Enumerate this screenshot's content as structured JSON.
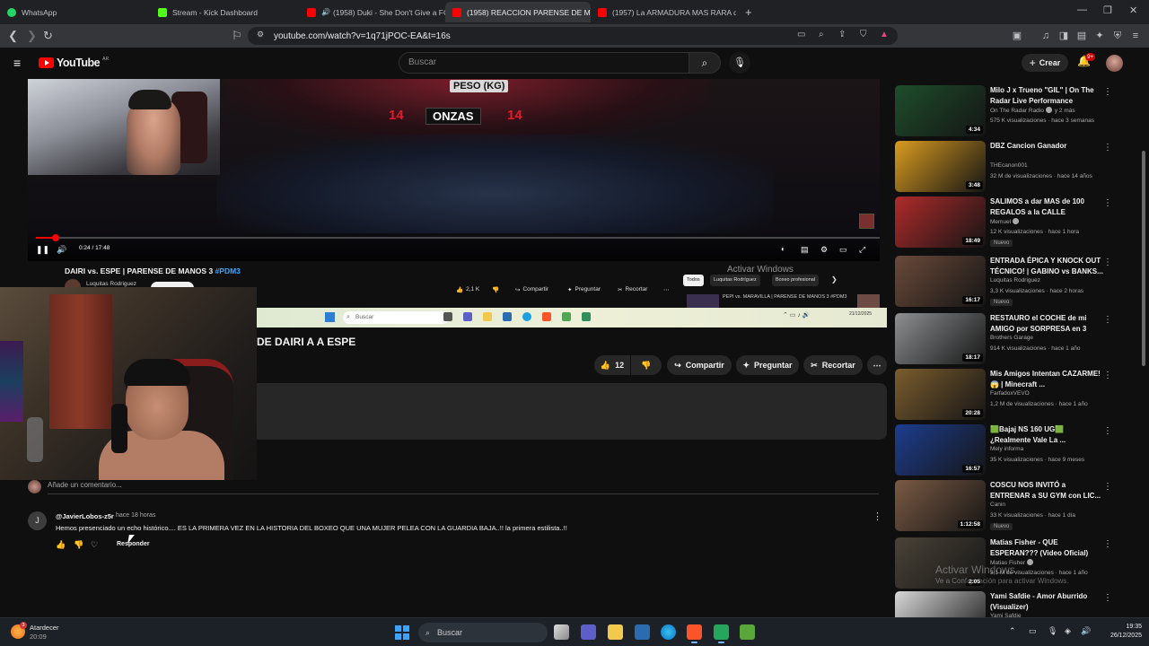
{
  "browser": {
    "tabs": [
      {
        "label": "WhatsApp",
        "fav_color": "#25d366",
        "active": false
      },
      {
        "label": "Stream - Kick Dashboard",
        "fav_color": "#53fc18",
        "active": false
      },
      {
        "label": "(1958) Duki - She Don't Give a FO",
        "fav_color": "#ff0000",
        "active": false
      },
      {
        "label": "(1958) REACCION PARENSE DE M",
        "fav_color": "#ff0000",
        "active": true
      },
      {
        "label": "(1957) La ARMADURA MAS RARA de",
        "fav_color": "#ff0000",
        "active": false
      }
    ],
    "new_tab": "+",
    "url": "youtube.com/watch?v=1q71jPOC-EA&t=16s"
  },
  "masthead": {
    "logo_text": "YouTube",
    "country_code": "AR",
    "search_placeholder": "Buscar",
    "create_label": "Crear",
    "notifications_count": "9+"
  },
  "player": {
    "scoreboard_peso": "PESO (KG)",
    "scoreboard_onzas": "ONZAS",
    "scoreboard_left": "14",
    "scoreboard_right": "14",
    "time": "0:24 / 17:48",
    "progress_fraction": 0.023
  },
  "inner_stream": {
    "title": "DAIRI vs. ESPE | PARENSE DE MANOS 3 ",
    "title_tag": "#PDM3",
    "channel": "Luquitas Rodriguez",
    "likes": "2,1 K",
    "share": "Compartir",
    "ask": "Preguntar",
    "clip": "Recortar",
    "activar": "Activar Windows",
    "chips": [
      "Todos",
      "Luquitas Rodríguez",
      "Boxeo profesional"
    ],
    "suggest_title": "PEPI vs. MARAVILLA | PARENSE DE MANOS 3 #PDM3",
    "taskbar_search": "Buscar",
    "taskbar_clock": "21/12/2025"
  },
  "video": {
    "title": "DE DAIRI A A ESPE",
    "likes": "12",
    "share_label": "Compartir",
    "ask_label": "Preguntar",
    "clip_label": "Recortar"
  },
  "comments": {
    "add_placeholder": "Añade un comentario...",
    "items": [
      {
        "avatar_letter": "J",
        "author": "@JavierLobos-z5r",
        "time": "hace 18 horas",
        "text": "Hemos presenciado un echo histórico.... ES LA PRIMERA VEZ EN LA HISTORIA DEL BOXEO QUE UNA MUJER PELEA CON LA GUARDIA BAJA..!! la primera estilista..!!",
        "reply_label": "Responder"
      }
    ]
  },
  "sidebar": {
    "items": [
      {
        "title": "Milo J x Trueno \"GIL\" | On The Radar Live Performance",
        "channel": "On The Radar Radio",
        "verified": true,
        "meta": "575 K visualizaciones · hace 3 semanas",
        "duration": "4:34",
        "is_new": false,
        "extra": "y 2 más",
        "thumb": "#1e4d2b"
      },
      {
        "title": "DBZ Cancion Ganador",
        "channel": "THEcanon001",
        "verified": false,
        "meta": "32 M de visualizaciones · hace 14 años",
        "duration": "3:48",
        "is_new": false,
        "extra": "",
        "thumb": "#d99b1f"
      },
      {
        "title": "SALIMOS a dar MAS de 100 REGALOS a la CALLE",
        "channel": "Memuel",
        "verified": true,
        "meta": "12 K visualizaciones · hace 1 hora",
        "duration": "18:49",
        "is_new": true,
        "extra": "",
        "thumb": "#b02a2a"
      },
      {
        "title": "ENTRADA ÉPICA Y KNOCK OUT TÉCNICO! | GABINO vs BANKS...",
        "channel": "Luquitas Rodriguez",
        "verified": false,
        "meta": "3,3 K visualizaciones · hace 2 horas",
        "duration": "16:17",
        "is_new": true,
        "extra": "",
        "thumb": "#6a4a3a"
      },
      {
        "title": "RESTAURO el COCHE de mi AMIGO por SORPRESA en 3 DÍAS...",
        "channel": "Brothers Garage",
        "verified": false,
        "meta": "914 K visualizaciones · hace 1 año",
        "duration": "18:17",
        "is_new": false,
        "extra": "",
        "thumb": "#8d8f91"
      },
      {
        "title": "Mis Amigos Intentan CAZARME! 😱 | Minecraft ...",
        "channel": "FarfadoxVEVO",
        "verified": false,
        "meta": "1,2 M de visualizaciones · hace 1 año",
        "duration": "20:28",
        "is_new": false,
        "extra": "",
        "thumb": "#7b5d2e"
      },
      {
        "title": "🟩Bajaj NS 160 UG🟩 ¿Realmente Vale La ...",
        "channel": "Mely informa",
        "verified": false,
        "meta": "35 K visualizaciones · hace 9 meses",
        "duration": "16:57",
        "is_new": false,
        "extra": "",
        "thumb": "#1d3d8f"
      },
      {
        "title": "COSCU NOS INVITÓ a ENTRENAR a SU GYM con LIC...",
        "channel": "Canin",
        "verified": false,
        "meta": "33 K visualizaciones · hace 1 día",
        "duration": "1:12:58",
        "is_new": true,
        "extra": "",
        "thumb": "#7a5a44"
      },
      {
        "title": "Matias Fisher - QUE ESPERAN??? (Video Oficial)",
        "channel": "Matias Fisher",
        "verified": true,
        "meta": "3,1 M de visualizaciones · hace 1 año",
        "duration": "2:05",
        "is_new": false,
        "extra": "",
        "thumb": "#4a4338"
      },
      {
        "title": "Yami Safdie - Amor Aburrido (Visualizer)",
        "channel": "Yami Safdie",
        "verified": false,
        "meta": "",
        "duration": "",
        "is_new": false,
        "extra": "",
        "thumb": "#d8d8d8"
      }
    ]
  },
  "watermark": {
    "title": "Activar Windows",
    "subtitle": "Ve a Configuración para activar Windows."
  },
  "taskbar": {
    "weather_label": "Atardecer",
    "weather_time": "20:09",
    "weather_badge": "3",
    "search_label": "Buscar",
    "time": "19:35",
    "date": "26/12/2025"
  }
}
